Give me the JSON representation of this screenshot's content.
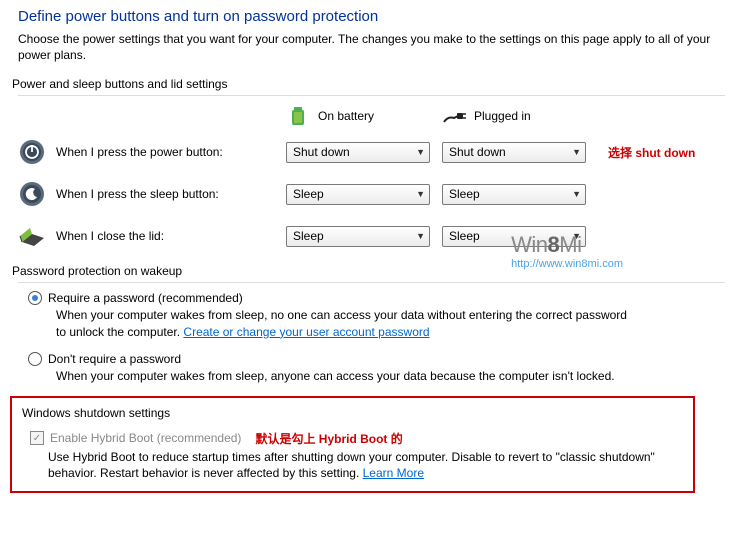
{
  "title": "Define power buttons and turn on password protection",
  "intro": "Choose the power settings that you want for your computer. The changes you make to the settings on this page apply to all of your power plans.",
  "section1_label": "Power and sleep buttons and lid settings",
  "columns": {
    "battery": "On battery",
    "plugged": "Plugged in"
  },
  "rows": [
    {
      "label": "When I press the power button:",
      "battery": "Shut down",
      "plugged": "Shut down"
    },
    {
      "label": "When I press the sleep button:",
      "battery": "Sleep",
      "plugged": "Sleep"
    },
    {
      "label": "When I close the lid:",
      "battery": "Sleep",
      "plugged": "Sleep"
    }
  ],
  "annotation1": "选择 shut down",
  "section2_label": "Password protection on wakeup",
  "opt_require": {
    "label": "Require a password (recommended)",
    "desc": "When your computer wakes from sleep, no one can access your data without entering the correct password to unlock the computer. ",
    "link": "Create or change your user account password"
  },
  "opt_norequire": {
    "label": "Don't require a password",
    "desc": "When your computer wakes from sleep, anyone can access your data because the computer isn't locked."
  },
  "section3_label": "Windows shutdown settings",
  "hybrid": {
    "label": "Enable Hybrid Boot (recommended)",
    "annot": "默认是勾上 Hybrid Boot 的",
    "desc": "Use Hybrid Boot to reduce startup times after shutting down your computer. Disable to revert to \"classic shutdown\" behavior. Restart behavior is never affected by this setting. ",
    "link": "Learn More"
  },
  "watermark": {
    "line1a": "Win",
    "line1b": "8",
    "line1c": "Mi",
    "line2": "http://www.win8mi.com"
  }
}
